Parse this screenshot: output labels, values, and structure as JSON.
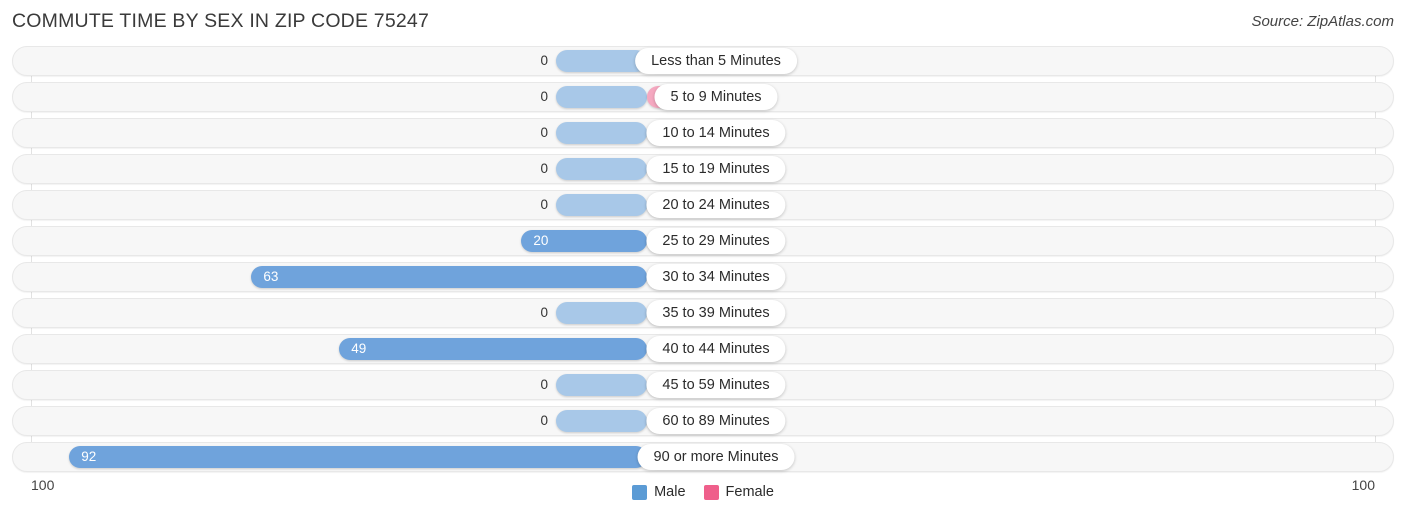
{
  "header": {
    "title": "COMMUTE TIME BY SEX IN ZIP CODE 75247",
    "source": "Source: ZipAtlas.com"
  },
  "axis": {
    "left_label": "100",
    "right_label": "100"
  },
  "legend": {
    "items": [
      {
        "label": "Male",
        "color": "#5b9bd5"
      },
      {
        "label": "Female",
        "color": "#ef5f8b"
      }
    ]
  },
  "colors": {
    "male_zero": "#a8c8e8",
    "male_value": "#6fa3dc",
    "female_zero": "#f5a8c0",
    "female_value": "#ef5f8b",
    "row_background": "#f7f7f7",
    "row_border": "#e8e8e8",
    "gridline": "#e2e2e2"
  },
  "chart_data": {
    "type": "bar",
    "title": "COMMUTE TIME BY SEX IN ZIP CODE 75247",
    "subtitle": "Source: ZipAtlas.com",
    "orientation": "horizontal-diverging",
    "xlabel": "",
    "ylabel": "",
    "xlim": [
      -100,
      100
    ],
    "axis_tick_labels": [
      "100",
      "100"
    ],
    "grid": true,
    "legend_position": "bottom-center",
    "categories": [
      "Less than 5 Minutes",
      "5 to 9 Minutes",
      "10 to 14 Minutes",
      "15 to 19 Minutes",
      "20 to 24 Minutes",
      "25 to 29 Minutes",
      "30 to 34 Minutes",
      "35 to 39 Minutes",
      "40 to 44 Minutes",
      "45 to 59 Minutes",
      "60 to 89 Minutes",
      "90 or more Minutes"
    ],
    "series": [
      {
        "name": "Male",
        "side": "left",
        "values": [
          0,
          0,
          0,
          0,
          0,
          20,
          63,
          0,
          49,
          0,
          0,
          92
        ]
      },
      {
        "name": "Female",
        "side": "right",
        "values": [
          0,
          0,
          0,
          0,
          0,
          0,
          0,
          0,
          0,
          0,
          0,
          0
        ]
      }
    ]
  }
}
